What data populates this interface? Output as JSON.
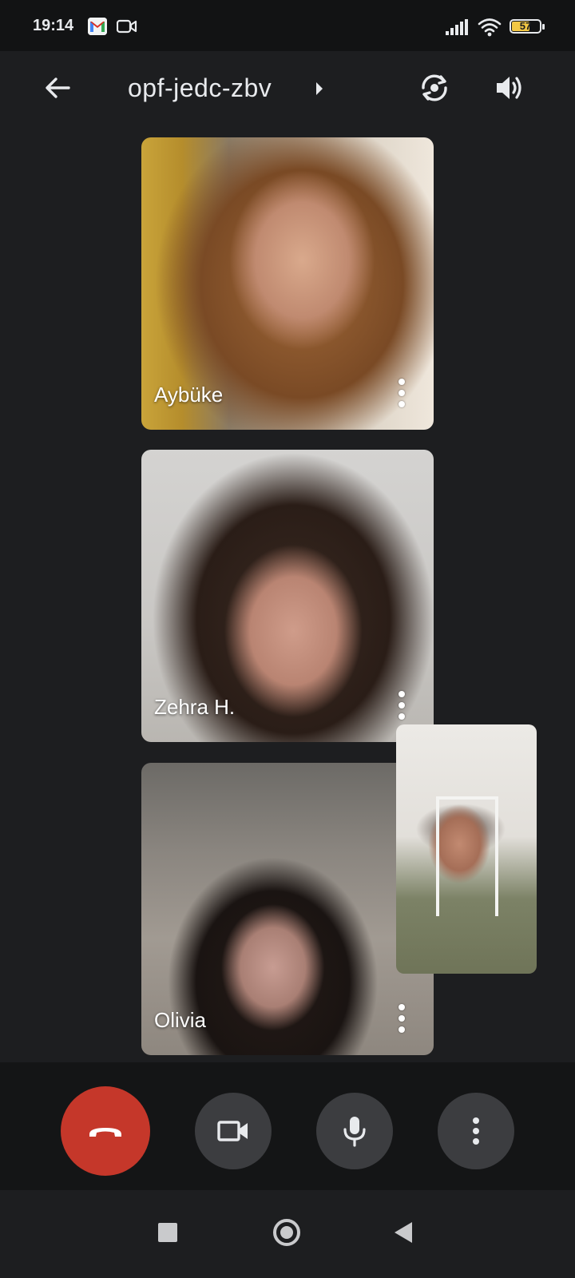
{
  "status_bar": {
    "time": "19:14",
    "battery": "57",
    "icons": [
      "gmail-icon",
      "video-notification-icon",
      "signal-icon",
      "wifi-icon",
      "battery-icon"
    ]
  },
  "header": {
    "meeting_code": "opf-jedc-zbv",
    "icons": [
      "back-arrow-icon",
      "caret-right-icon",
      "switch-camera-icon",
      "speaker-icon"
    ]
  },
  "participants": [
    {
      "name": "Aybüke"
    },
    {
      "name": "Zehra H."
    },
    {
      "name": "Olivia"
    }
  ],
  "controls": {
    "buttons": [
      "end-call",
      "camera",
      "microphone",
      "more-options"
    ],
    "colors": {
      "end_call": "#c5372a",
      "control_bg": "#3c3d40"
    }
  },
  "colors": {
    "background": "#1d1e20",
    "battery_fill": "#f2c744"
  }
}
